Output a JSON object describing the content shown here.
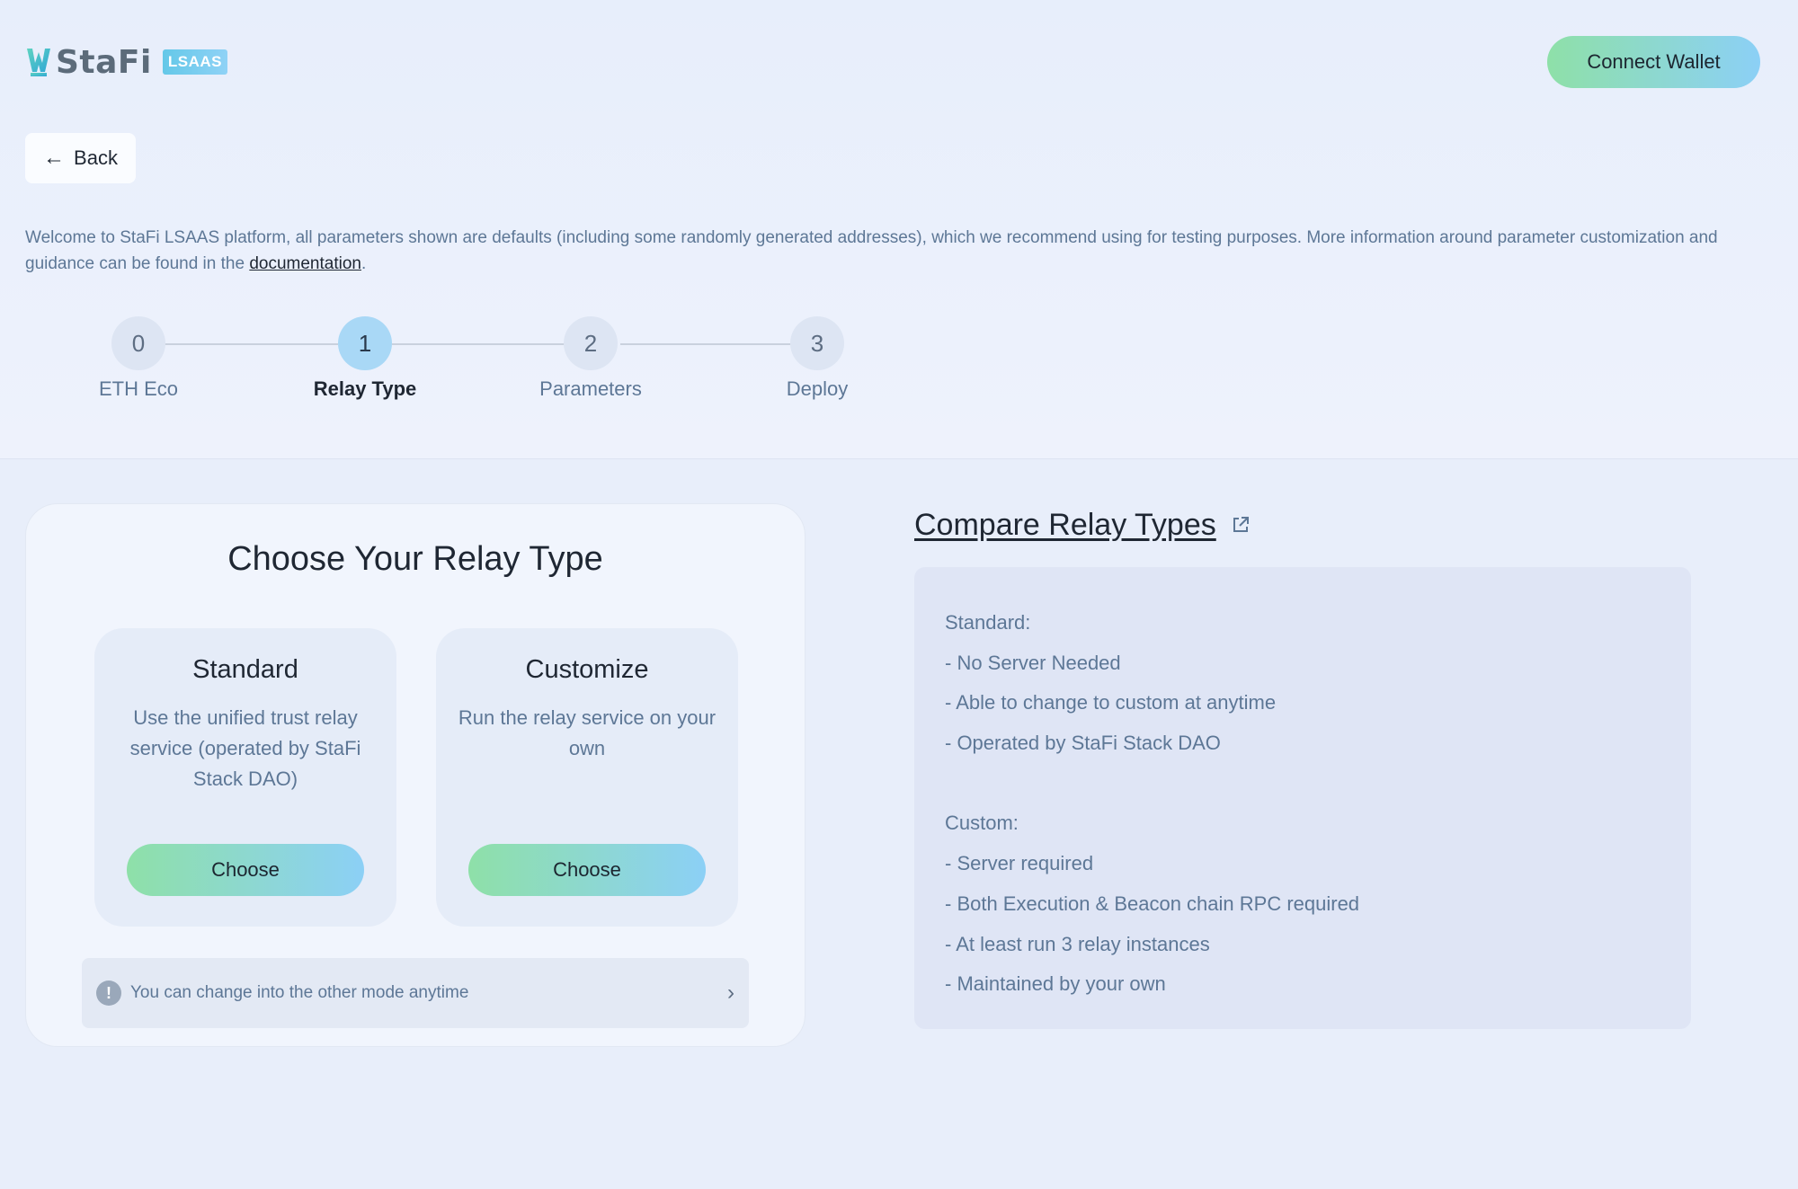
{
  "header": {
    "logo_text": "StaFi",
    "logo_badge": "LSAAS",
    "connect_label": "Connect Wallet"
  },
  "back_label": "Back",
  "intro": {
    "text_before": "Welcome to StaFi LSAAS platform, all parameters shown are defaults (including some randomly generated addresses), which we recommend using for testing purposes. More information around parameter customization and guidance can be found in the ",
    "link_text": "documentation",
    "text_after": "."
  },
  "stepper": {
    "active_index": 1,
    "steps": [
      {
        "number": "0",
        "label": "ETH Eco"
      },
      {
        "number": "1",
        "label": "Relay Type"
      },
      {
        "number": "2",
        "label": "Parameters"
      },
      {
        "number": "3",
        "label": "Deploy"
      }
    ]
  },
  "relay_card": {
    "title": "Choose Your Relay Type",
    "options": [
      {
        "title": "Standard",
        "description": "Use the unified trust relay service (operated by StaFi Stack DAO)",
        "button": "Choose"
      },
      {
        "title": "Customize",
        "description": "Run the relay service on your own",
        "button": "Choose"
      }
    ],
    "notice": "You can change into the other mode anytime"
  },
  "compare": {
    "title": "Compare Relay Types",
    "lines": [
      "Standard:",
      "- No Server Needed",
      "- Able to change to custom at anytime",
      "- Operated by StaFi Stack DAO",
      "",
      "Custom:",
      "- Server required",
      "- Both Execution & Beacon chain RPC required",
      "- At least run 3 relay instances",
      "- Maintained by your own"
    ]
  },
  "colors": {
    "accent_gradient_start": "#8ee0a8",
    "accent_gradient_end": "#8cd0f6",
    "active_step": "#a9d8f6",
    "muted_text": "#5d7796"
  }
}
